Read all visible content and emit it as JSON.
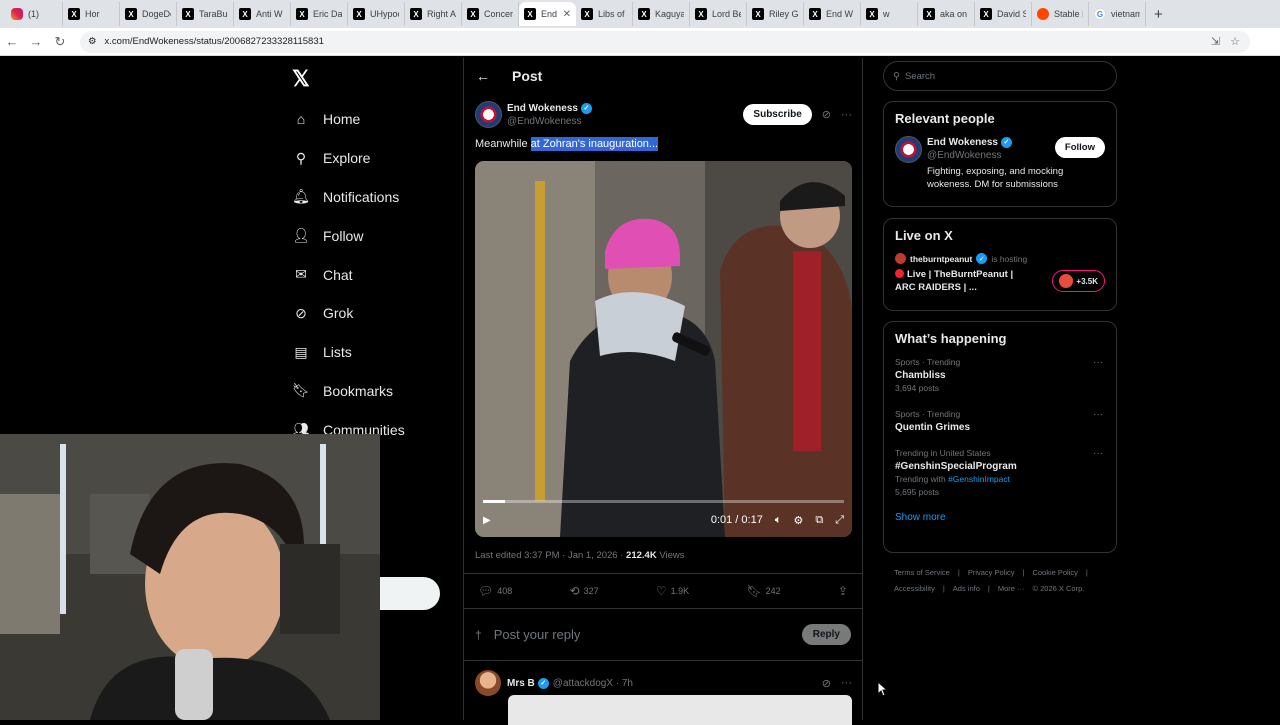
{
  "browser": {
    "tabs": [
      {
        "label": "(1)",
        "icon": "instagram"
      },
      {
        "label": "Hor",
        "icon": "x"
      },
      {
        "label": "DogeDe",
        "icon": "x"
      },
      {
        "label": "TaraBul",
        "icon": "x"
      },
      {
        "label": "Anti W",
        "icon": "x"
      },
      {
        "label": "Eric Da",
        "icon": "x"
      },
      {
        "label": "UHypoc",
        "icon": "x"
      },
      {
        "label": "Right A",
        "icon": "x"
      },
      {
        "label": "Concer",
        "icon": "x"
      },
      {
        "label": "End",
        "icon": "x",
        "active": true
      },
      {
        "label": "Libs of",
        "icon": "x"
      },
      {
        "label": "Kaguya",
        "icon": "x"
      },
      {
        "label": "Lord Be",
        "icon": "x"
      },
      {
        "label": "Riley G",
        "icon": "x"
      },
      {
        "label": "End W",
        "icon": "x"
      },
      {
        "label": "w",
        "icon": "x"
      },
      {
        "label": "aka on",
        "icon": "x"
      },
      {
        "label": "David S",
        "icon": "x"
      },
      {
        "label": "Stable I",
        "icon": "reddit"
      },
      {
        "label": "vietnam",
        "icon": "google"
      }
    ],
    "url": "x.com/EndWokeness/status/2006827233328115831"
  },
  "nav": {
    "logo": "𝕏",
    "items": [
      {
        "label": "Home",
        "icon": "⌂",
        "name": "home"
      },
      {
        "label": "Explore",
        "icon": "⚲",
        "name": "explore"
      },
      {
        "label": "Notifications",
        "icon": "🔔︎",
        "name": "notifications"
      },
      {
        "label": "Follow",
        "icon": "👤︎",
        "name": "follow"
      },
      {
        "label": "Chat",
        "icon": "✉",
        "name": "chat"
      },
      {
        "label": "Grok",
        "icon": "⊘",
        "name": "grok"
      },
      {
        "label": "Lists",
        "icon": "▤",
        "name": "lists"
      },
      {
        "label": "Bookmarks",
        "icon": "🔖︎",
        "name": "bookmarks"
      },
      {
        "label": "Communities",
        "icon": "👥︎",
        "name": "communities"
      }
    ]
  },
  "post": {
    "header_title": "Post",
    "author_name": "End Wokeness",
    "author_handle": "@EndWokeness",
    "subscribe_label": "Subscribe",
    "text_before": "Meanwhile ",
    "text_selected": "at Zohran's inauguration...",
    "video_time": "0:01 / 0:17",
    "video_progress": 0.06,
    "edited": "Last edited 3:37 PM · Jan 1, 2026 · ",
    "views_count": "212.4K",
    "views_label": " Views",
    "replies": "408",
    "reposts": "327",
    "likes": "1.9K",
    "bookmarks": "242"
  },
  "reply_box": {
    "placeholder": "Post your reply",
    "button": "Reply"
  },
  "reply": {
    "name": "Mrs B",
    "handle": "@attackdogX · 7h"
  },
  "sidebar": {
    "search_placeholder": "Search",
    "relevant": {
      "title": "Relevant people",
      "name": "End Wokeness",
      "handle": "@EndWokeness",
      "follow_label": "Follow",
      "bio": "Fighting, exposing, and mocking wokeness. DM for submissions"
    },
    "live": {
      "title": "Live on X",
      "host": "theburntpeanut",
      "host_suffix": " is hosting",
      "stream_title": "Live | TheBurntPeanut | ARC RAIDERS | ...",
      "listeners": "+3.5K"
    },
    "happening": {
      "title": "What’s happening",
      "trends": [
        {
          "category": "Sports · Trending",
          "name": "Chambliss",
          "count": "3,694 posts"
        },
        {
          "category": "Sports · Trending",
          "name": "Quentin Grimes",
          "count": ""
        },
        {
          "category": "Trending in United States",
          "name": "#GenshinSpecialProgram",
          "with_label": "Trending with ",
          "with_tag": "#GenshinImpact",
          "count": "5,695 posts"
        }
      ],
      "show_more": "Show more"
    },
    "footer": [
      "Terms of Service",
      "|",
      "Privacy Policy",
      "|",
      "Cookie Policy",
      "|",
      "Accessibility",
      "|",
      "Ads info",
      "|",
      "More ···",
      "© 2026 X Corp."
    ]
  },
  "colors": {
    "accent": "#1d9bf0",
    "selection": "#3367d6",
    "live": "#f91880"
  }
}
